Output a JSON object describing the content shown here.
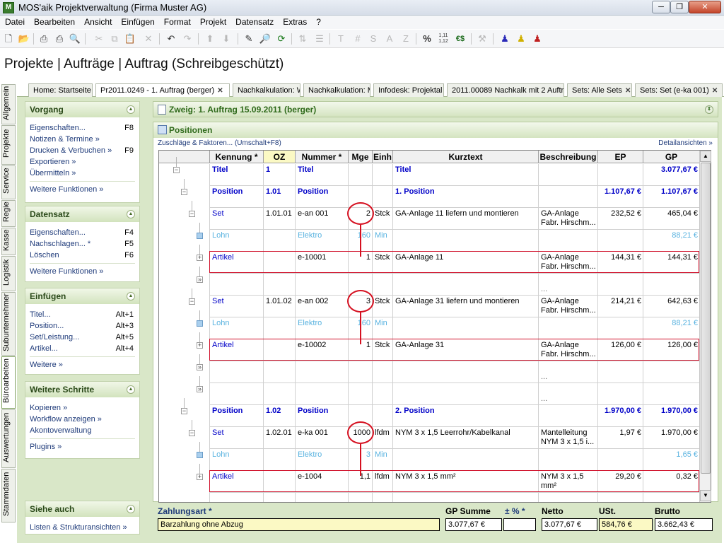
{
  "window": {
    "title": "MOS'aik Projektverwaltung (Firma Muster AG)",
    "app_icon_letter": "M"
  },
  "menu": [
    "Datei",
    "Bearbeiten",
    "Ansicht",
    "Einfügen",
    "Format",
    "Projekt",
    "Datensatz",
    "Extras",
    "?"
  ],
  "toolbar": {
    "text_buttons": [
      "T",
      "#",
      "S",
      "A",
      "Z",
      "%",
      "1,11\n1,12",
      "€$"
    ]
  },
  "header": {
    "breadcrumb": "Projekte | Aufträge | Auftrag (Schreibgeschützt)"
  },
  "tabs": [
    {
      "label": "Home: Startseite",
      "closable": false
    },
    {
      "label": "Pr2011.0249 - 1. Auftrag (berger)",
      "closable": true,
      "active": true
    },
    {
      "label": "Nachkalkulation: W",
      "closable": false
    },
    {
      "label": "Nachkalkulation: M",
      "closable": false
    },
    {
      "label": "Infodesk: Projektal",
      "closable": false
    },
    {
      "label": "2011.00089 Nachkalk mit 2 Auftr",
      "closable": false
    },
    {
      "label": "Sets: Alle Sets",
      "closable": true
    },
    {
      "label": "Sets: Set (e-ka 001)",
      "closable": true
    }
  ],
  "vertical_tabs": [
    "Allgemein",
    "Projekte",
    "Service",
    "Regie",
    "Kasse",
    "Logistik",
    "Subunternehmer",
    "Büroarbeiten",
    "Auswertungen",
    "Stammdaten"
  ],
  "left_panels": {
    "vorgang": {
      "title": "Vorgang",
      "items": [
        {
          "label": "Eigenschaften...",
          "key": "F8"
        },
        {
          "label": "Notizen & Termine »",
          "key": ""
        },
        {
          "label": "Drucken & Verbuchen »",
          "key": "F9"
        },
        {
          "label": "Exportieren »",
          "key": ""
        },
        {
          "label": "Übermitteln »",
          "key": ""
        }
      ],
      "more": "Weitere Funktionen »"
    },
    "datensatz": {
      "title": "Datensatz",
      "items": [
        {
          "label": "Eigenschaften...",
          "key": "F4"
        },
        {
          "label": "Nachschlagen... *",
          "key": "F5"
        },
        {
          "label": "Löschen",
          "key": "F6"
        }
      ],
      "more": "Weitere Funktionen »"
    },
    "einfuegen": {
      "title": "Einfügen",
      "items": [
        {
          "label": "Titel...",
          "key": "Alt+1"
        },
        {
          "label": "Position...",
          "key": "Alt+3"
        },
        {
          "label": "Set/Leistung...",
          "key": "Alt+5"
        },
        {
          "label": "Artikel...",
          "key": "Alt+4"
        }
      ],
      "more": "Weitere »"
    },
    "weitere": {
      "title": "Weitere Schritte",
      "items": [
        {
          "label": "Kopieren »",
          "key": ""
        },
        {
          "label": "Workflow anzeigen »",
          "key": ""
        },
        {
          "label": "Akontoverwaltung",
          "key": ""
        }
      ],
      "more": "Plugins »"
    },
    "siehe": {
      "title": "Siehe auch",
      "items": [
        {
          "label": "Listen & Strukturansichten »",
          "key": ""
        }
      ]
    }
  },
  "zweig": {
    "label": "Zweig: 1. Auftrag 15.09.2011 (berger)"
  },
  "positionen": {
    "title": "Positionen",
    "link_left": "Zuschläge & Faktoren... (Umschalt+F8)",
    "link_right": "Detailansichten »",
    "columns": [
      "Kennung *",
      "OZ",
      "Nummer *",
      "Mge",
      "Einh",
      "Kurztext",
      "Beschreibung",
      "EP",
      "GP"
    ],
    "rows": [
      {
        "kind": "titel",
        "kennung": "Titel",
        "oz": "1",
        "nummer": "Titel",
        "mge": "",
        "einh": "",
        "kurztext": "Titel",
        "beschreibung": "",
        "ep": "",
        "gp": "3.077,67 €"
      },
      {
        "kind": "position",
        "kennung": "Position",
        "oz": "1.01",
        "nummer": "Position",
        "mge": "",
        "einh": "",
        "kurztext": "1. Position",
        "beschreibung": "",
        "ep": "1.107,67 €",
        "gp": "1.107,67 €"
      },
      {
        "kind": "set",
        "kennung": "Set",
        "oz": "1.01.01",
        "nummer": "e-an 001",
        "mge": "2",
        "einh": "Stck",
        "kurztext": "GA-Anlage 11 liefern und montieren",
        "beschreibung": "GA-Anlage",
        "beschreibung2": "Fabr. Hirschm...",
        "ep": "232,52 €",
        "gp": "465,04 €"
      },
      {
        "kind": "lohn",
        "kennung": "Lohn",
        "oz": "",
        "nummer": "Elektro",
        "mge": "160",
        "einh": "Min",
        "kurztext": "",
        "beschreibung": "",
        "ep": "",
        "gp": "88,21 €"
      },
      {
        "kind": "artikel",
        "kennung": "Artikel",
        "oz": "",
        "nummer": "e-10001",
        "mge": "1",
        "einh": "Stck",
        "kurztext": "GA-Anlage 11",
        "beschreibung": "GA-Anlage",
        "beschreibung2": "Fabr. Hirschm...",
        "ep": "144,31 €",
        "gp": "144,31 €"
      },
      {
        "kind": "more",
        "beschreibung": "..."
      },
      {
        "kind": "set",
        "kennung": "Set",
        "oz": "1.01.02",
        "nummer": "e-an 002",
        "mge": "3",
        "einh": "Stck",
        "kurztext": "GA-Anlage 31 liefern und montieren",
        "beschreibung": "GA-Anlage",
        "beschreibung2": "Fabr. Hirschm...",
        "ep": "214,21 €",
        "gp": "642,63 €"
      },
      {
        "kind": "lohn",
        "kennung": "Lohn",
        "oz": "",
        "nummer": "Elektro",
        "mge": "160",
        "einh": "Min",
        "kurztext": "",
        "beschreibung": "",
        "ep": "",
        "gp": "88,21 €"
      },
      {
        "kind": "artikel",
        "kennung": "Artikel",
        "oz": "",
        "nummer": "e-10002",
        "mge": "1",
        "einh": "Stck",
        "kurztext": "GA-Anlage 31",
        "beschreibung": "GA-Anlage",
        "beschreibung2": "Fabr. Hirschm...",
        "ep": "126,00 €",
        "gp": "126,00 €"
      },
      {
        "kind": "more",
        "beschreibung": "..."
      },
      {
        "kind": "more",
        "beschreibung": "..."
      },
      {
        "kind": "position",
        "kennung": "Position",
        "oz": "1.02",
        "nummer": "Position",
        "mge": "",
        "einh": "",
        "kurztext": "2. Position",
        "beschreibung": "",
        "ep": "1.970,00 €",
        "gp": "1.970,00 €"
      },
      {
        "kind": "set",
        "kennung": "Set",
        "oz": "1.02.01",
        "nummer": "e-ka 001",
        "mge": "1000",
        "einh": "lfdm",
        "kurztext": "NYM 3 x 1,5 Leerrohr/Kabelkanal",
        "beschreibung": "Mantelleitung",
        "beschreibung2": "NYM 3 x 1,5 i...",
        "ep": "1,97 €",
        "gp": "1.970,00 €"
      },
      {
        "kind": "lohn",
        "kennung": "Lohn",
        "oz": "",
        "nummer": "Elektro",
        "mge": "3",
        "einh": "Min",
        "kurztext": "",
        "beschreibung": "",
        "ep": "",
        "gp": "1,65 €"
      },
      {
        "kind": "artikel",
        "kennung": "Artikel",
        "oz": "",
        "nummer": "e-1004",
        "mge": "1,1",
        "einh": "lfdm",
        "kurztext": "NYM 3 x 1,5 mm²",
        "beschreibung": "NYM 3 x 1,5",
        "beschreibung2": "mm²",
        "ep": "29,20 €",
        "gp": "0,32 €"
      }
    ]
  },
  "footer": {
    "zahlungsart_label": "Zahlungsart *",
    "zahlungsart_value": "Barzahlung ohne Abzug",
    "gp_summe_label": "GP Summe",
    "gp_summe_value": "3.077,67 €",
    "pct_label": "± % *",
    "pct_value": "",
    "netto_label": "Netto",
    "netto_value": "3.077,67 €",
    "ust_label": "USt.",
    "ust_value": "584,76 €",
    "brutto_label": "Brutto",
    "brutto_value": "3.662,43 €"
  },
  "colors": {
    "panel_bg": "#d9e7c8",
    "link_blue": "#1f3b7a",
    "highlight_red": "#d51020",
    "position_blue": "#0000c8"
  }
}
